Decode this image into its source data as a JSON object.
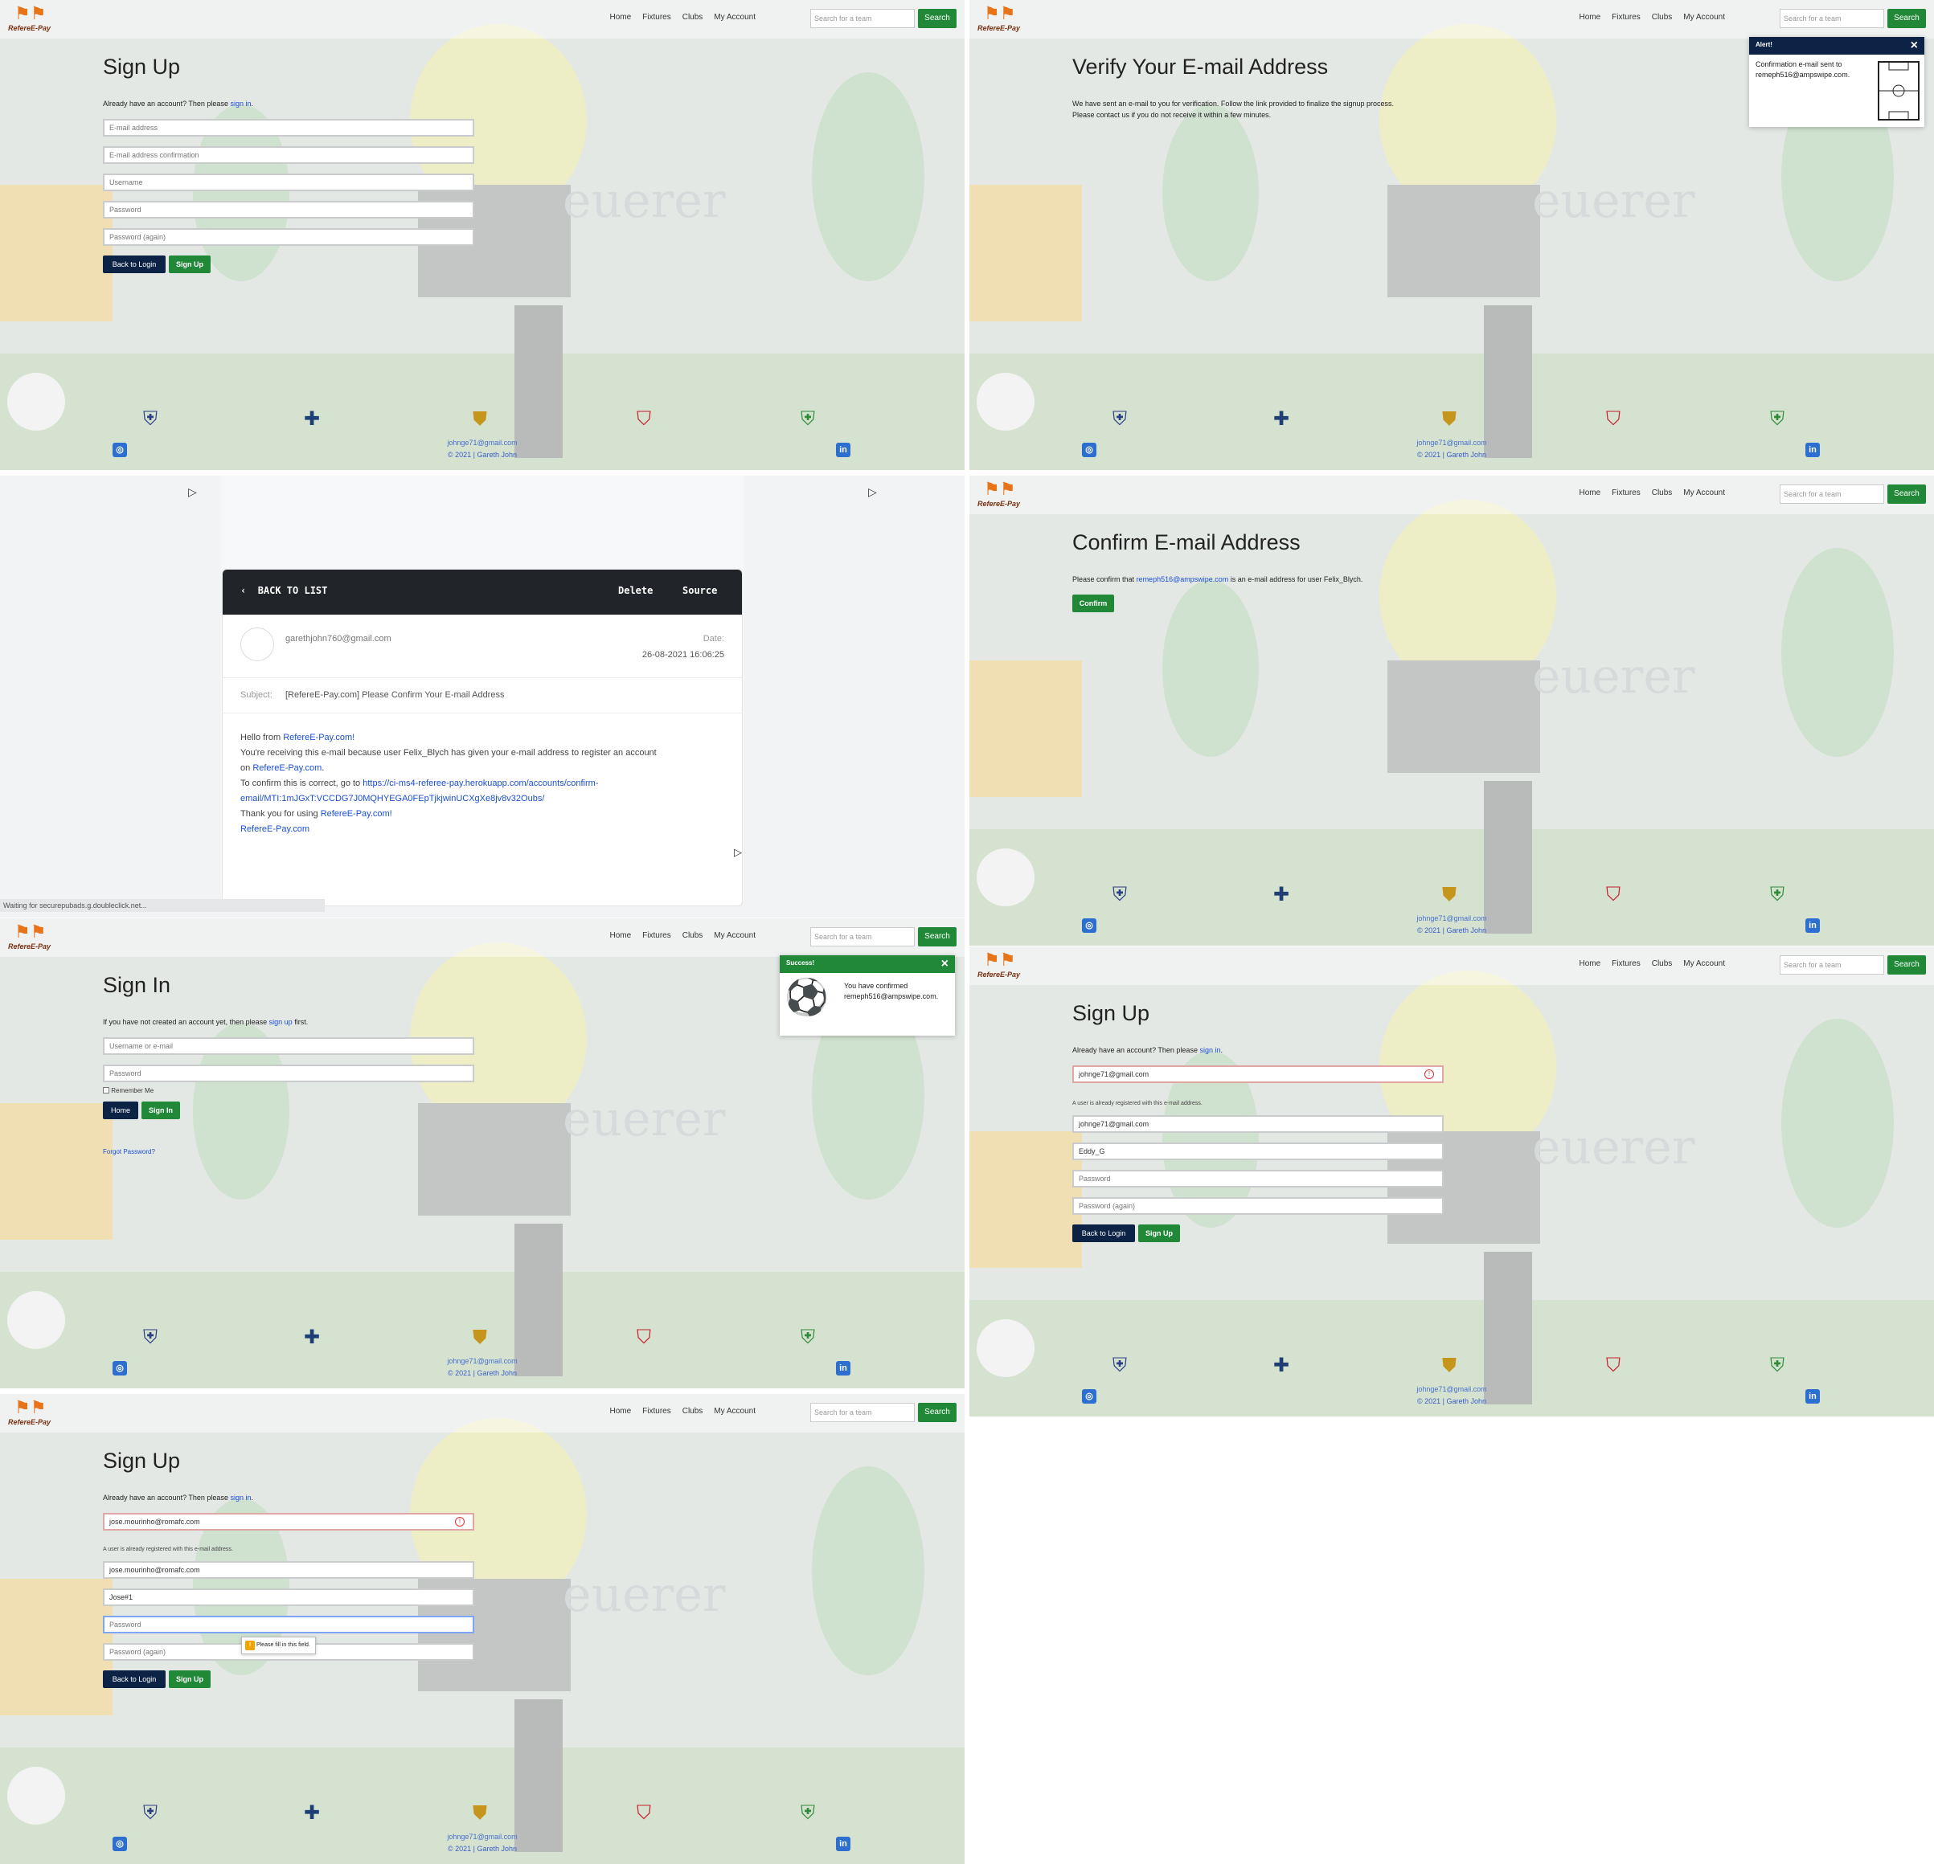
{
  "nav": {
    "brand": "RefereE-Pay",
    "home": "Home",
    "fixtures": "Fixtures",
    "clubs": "Clubs",
    "account": "My Account",
    "search_placeholder": "Search for a team",
    "search_button": "Search"
  },
  "footer": {
    "email": "johnge71@gmail.com",
    "copyright": "© 2021 | Gareth John"
  },
  "signup1": {
    "title": "Sign Up",
    "prompt": "Already have an account? Then please",
    "prompt_link": "sign in",
    "email_placeholder": "E-mail address",
    "email2_placeholder": "E-mail address confirmation",
    "username_placeholder": "Username",
    "password_placeholder": "Password",
    "password2_placeholder": "Password (again)",
    "back_button": "Back to Login",
    "signup_button": "Sign Up"
  },
  "verify": {
    "title": "Verify Your E-mail Address",
    "line1": "We have sent an e-mail to you for verification. Follow the link provided to finalize the signup process.",
    "line2": "Please contact us if you do not receive it within a few minutes.",
    "alert_title": "Alert!",
    "alert_text": "Confirmation e-mail sent to remeph516@ampswipe.com."
  },
  "email": {
    "back": "BACK TO LIST",
    "delete": "Delete",
    "source": "Source",
    "from": "garethjohn760@gmail.com",
    "date_label": "Date:",
    "date": "26-08-2021 16:06:25",
    "subject_label": "Subject:",
    "subject": "[RefereE-Pay.com] Please Confirm Your E-mail Address",
    "hello": "Hello from",
    "hello_link": "RefereE-Pay.com!",
    "body1": "You're receiving this e-mail because user Felix_Blych has given your e-mail address to register an account",
    "body2_pre": "on",
    "body2_link": "RefereE-Pay.com.",
    "body3": "To confirm this is correct, go to",
    "confirm_link": "https://ci-ms4-referee-pay.herokuapp.com/accounts/confirm-",
    "confirm_link2": "email/MTI:1mJGxT:VCCDG7J0MQHYEGA0FEpTjkjwinUCXgXe8jv8v32Oubs/",
    "thanks": "Thank you for using",
    "thanks_link": "RefereE-Pay.com!",
    "sign": "RefereE-Pay.com",
    "status": "Waiting for securepubads.g.doubleclick.net..."
  },
  "confirm": {
    "title": "Confirm E-mail Address",
    "text_pre": "Please confirm that",
    "text_link": "remeph516@ampswipe.com",
    "text_post": "is an e-mail address for user Felix_Blych.",
    "button": "Confirm"
  },
  "signin": {
    "title": "Sign In",
    "prompt": "If you have not created an account yet, then please",
    "prompt_link": "sign up",
    "prompt_post": "first.",
    "user_placeholder": "Username or e-mail",
    "password_placeholder": "Password",
    "remember": "Remember Me",
    "home_button": "Home",
    "signin_button": "Sign In",
    "forgot": "Forgot Password?",
    "toast_title": "Success!",
    "toast_text": "You have confirmed remeph516@ampswipe.com."
  },
  "signup2": {
    "title": "Sign Up",
    "prompt": "Already have an account? Then please",
    "prompt_link": "sign in",
    "email_value": "johnge71@gmail.com",
    "error": "A user is already registered with this e-mail address.",
    "email2_value": "johnge71@gmail.com",
    "username_value": "Eddy_G",
    "password_placeholder": "Password",
    "password2_placeholder": "Password (again)",
    "back_button": "Back to Login",
    "signup_button": "Sign Up"
  },
  "signup3": {
    "title": "Sign Up",
    "prompt": "Already have an account? Then please",
    "prompt_link": "sign in",
    "email_value": "jose.mourinho@romafc.com",
    "error": "A user is already registered with this e-mail address.",
    "email2_value": "jose.mourinho@romafc.com",
    "username_value": "Jose#1",
    "password_placeholder": "Password",
    "password2_placeholder": "Password (again)",
    "tooltip": "Please fill in this field.",
    "back_button": "Back to Login",
    "signup_button": "Sign Up"
  },
  "icons": [
    "england-crest-icon",
    "northern-ireland-crest-icon",
    "scotland-crest-icon",
    "wales-crest-icon",
    "ireland-crest-icon",
    "instagram-icon",
    "linkedin-icon",
    "play-icon"
  ]
}
